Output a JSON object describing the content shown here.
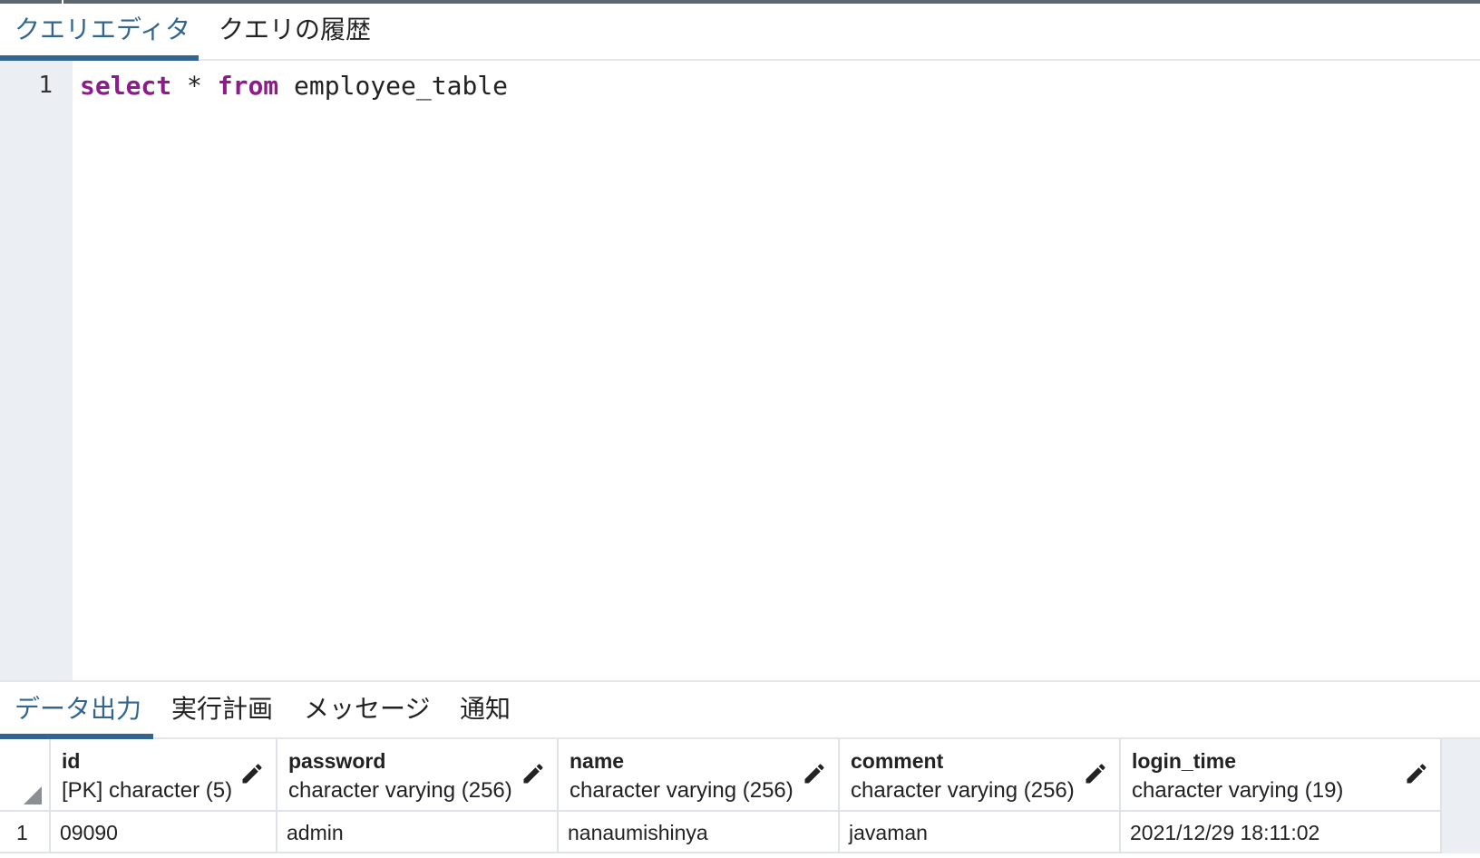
{
  "query_tabs": [
    {
      "label": "クエリエディタ",
      "active": true
    },
    {
      "label": "クエリの履歴",
      "active": false
    }
  ],
  "editor": {
    "line_number": "1",
    "keyword_select": "select",
    "operator_star": "*",
    "keyword_from": "from",
    "table_name": "employee_table"
  },
  "output_tabs": [
    {
      "label": "データ出力",
      "active": true
    },
    {
      "label": "実行計画",
      "active": false
    },
    {
      "label": "メッセージ",
      "active": false
    },
    {
      "label": "通知",
      "active": false
    }
  ],
  "grid": {
    "columns": [
      {
        "name": "id",
        "type": "[PK] character (5)"
      },
      {
        "name": "password",
        "type": "character varying (256)"
      },
      {
        "name": "name",
        "type": "character varying (256)"
      },
      {
        "name": "comment",
        "type": "character varying (256)"
      },
      {
        "name": "login_time",
        "type": "character varying (19)"
      }
    ],
    "rows": [
      {
        "row_number": "1",
        "cells": [
          "09090",
          "admin",
          "nanaumishinya",
          "javaman",
          "2021/12/29 18:11:02"
        ]
      }
    ]
  },
  "colors": {
    "accent": "#326690",
    "keyword": "#8e1a8c",
    "gutter": "#ebeef3",
    "border": "#dfe2e6"
  },
  "icons": {
    "edit_column": "pencil-icon",
    "select_all": "select-all-corner-icon"
  }
}
